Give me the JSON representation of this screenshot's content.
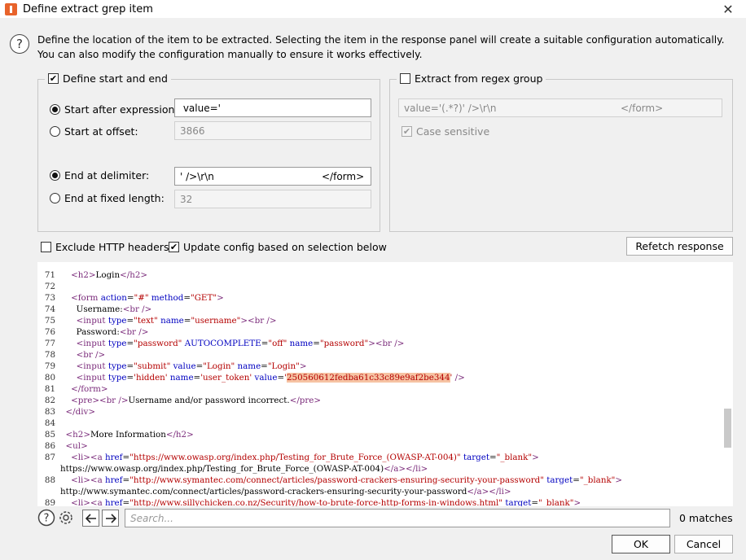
{
  "window": {
    "title": "Define extract grep item"
  },
  "intro": "Define the location of the item to be extracted. Selecting the item in the response panel will create a suitable configuration automatically. You can also modify the configuration manually to ensure it works effectively.",
  "start_end": {
    "legend": "Define start and end",
    "checked": true,
    "start_after_label": "Start after expression:",
    "start_after_value": " value='",
    "start_offset_label": "Start at offset:",
    "start_offset_value": "3866",
    "end_delim_label": "End at delimiter:",
    "end_delim_value": "' />\\r\\n",
    "end_delim_value_tail": "</form>",
    "end_fixed_label": "End at fixed length:",
    "end_fixed_value": "32"
  },
  "regex": {
    "legend": "Extract from regex group",
    "checked": false,
    "value": "value='(.*?)' />\\r\\n",
    "value_tail": "</form>",
    "case_label": "Case sensitive",
    "case_checked": true
  },
  "options": {
    "exclude_headers": "Exclude HTTP headers",
    "exclude_checked": false,
    "update_config": "Update config based on selection below",
    "update_checked": true,
    "refetch": "Refetch response"
  },
  "code": {
    "highlight_value": "250560612fedba61c33c89e9af2be344"
  },
  "search": {
    "placeholder": "Search...",
    "matches": "0 matches"
  },
  "buttons": {
    "ok": "OK",
    "cancel": "Cancel"
  }
}
